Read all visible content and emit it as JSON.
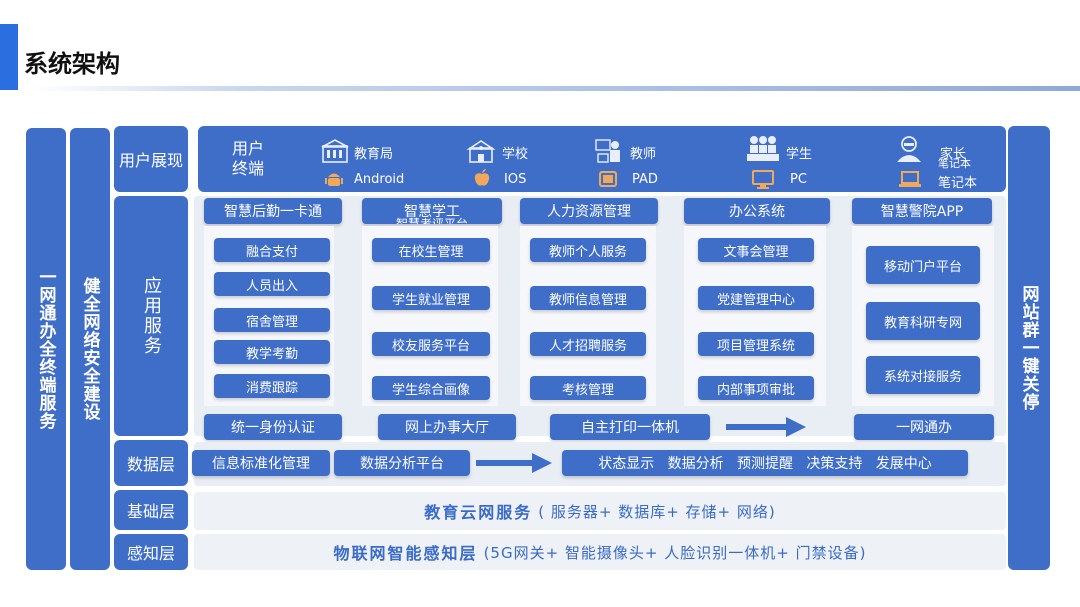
{
  "page": {
    "title": "系统架构"
  },
  "left_columns": {
    "col1": "一网通办全终端服务",
    "col2": "健全网络安全建设"
  },
  "right_column": "网站群一键关停",
  "layers": {
    "user": "用户展现",
    "app": "应用服务",
    "data": "数据层",
    "base": "基础层",
    "sense": "感知层"
  },
  "user_terminal": {
    "label": "用户终端",
    "roles": [
      {
        "icon": "building-icon",
        "label": "教育局"
      },
      {
        "icon": "school-icon",
        "label": "学校"
      },
      {
        "icon": "teacher-icon",
        "label": "教师"
      },
      {
        "icon": "students-icon",
        "label": "学生"
      },
      {
        "icon": "parent-icon",
        "label": "家长"
      }
    ],
    "parent_sub": "笔记本",
    "devices": [
      {
        "icon": "android-icon",
        "label": "Android"
      },
      {
        "icon": "apple-icon",
        "label": "IOS"
      },
      {
        "icon": "tablet-icon",
        "label": "PAD"
      },
      {
        "icon": "monitor-icon",
        "label": "PC"
      },
      {
        "icon": "laptop-icon",
        "label": "笔记本"
      }
    ]
  },
  "app_columns": [
    {
      "title": "智慧后勤一卡通",
      "items": [
        "融合支付",
        "人员出入",
        "宿舍管理",
        "教学考勤",
        "消费跟踪"
      ]
    },
    {
      "title": "智慧学工",
      "title_sub": "智慧考评平台",
      "items": [
        "在校生管理",
        "学生就业管理",
        "校友服务平台",
        "学生综合画像"
      ]
    },
    {
      "title": "人力资源管理",
      "items": [
        "教师个人服务",
        "教师信息管理",
        "人才招聘服务",
        "考核管理"
      ]
    },
    {
      "title": "办公系统",
      "items": [
        "文事会管理",
        "党建管理中心",
        "项目管理系统",
        "内部事项审批"
      ]
    },
    {
      "title": "智慧警院APP",
      "items": [
        "移动门户平台",
        "教育科研专网",
        "系统对接服务"
      ]
    }
  ],
  "app_bottom": [
    "统一身份认证",
    "网上办事大厅",
    "自主打印一体机",
    "一网通办"
  ],
  "data_layer": {
    "items": [
      "信息标准化管理",
      "数据分析平台"
    ],
    "outputs": "状态显示   数据分析   预测提醒   决策支持   发展中心"
  },
  "base_layer": {
    "bold": "教育云网服务",
    "normal": "( 服务器+ 数据库+ 存储+ 网络)"
  },
  "sense_layer": {
    "bold": "物联网智能感知层",
    "normal": "(5G网关+ 智能摄像头+ 人脸识别一体机+ 门禁设备)"
  },
  "colors": {
    "primary": "#3f6ec9",
    "accent": "#2a6ee0",
    "panel": "#e9edf4"
  }
}
